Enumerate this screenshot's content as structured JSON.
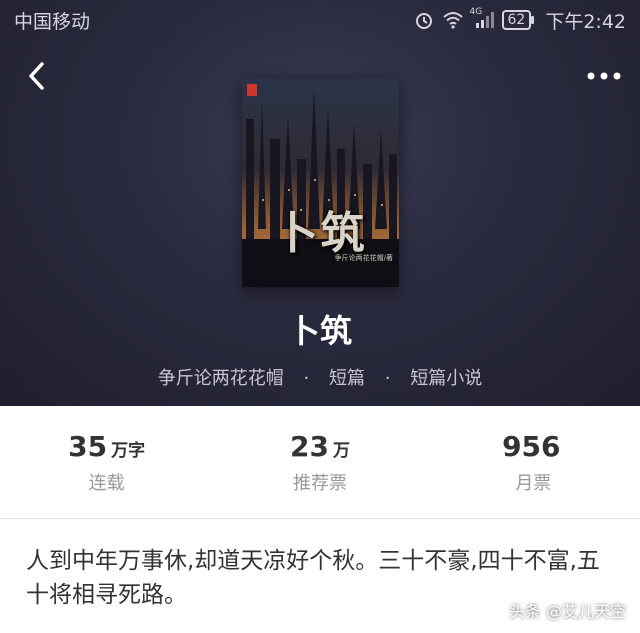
{
  "status_bar": {
    "carrier": "中国移动",
    "network": "4G",
    "battery": "62",
    "time": "下午2:42",
    "icons": [
      "alarm-icon",
      "wifi-icon",
      "signal-icon",
      "battery-icon"
    ]
  },
  "nav": {
    "back_icon": "chevron-left-icon",
    "more_icon": "more-dots-icon"
  },
  "cover": {
    "title": "卜筑",
    "author_line": "争斤论两花花帽/著"
  },
  "book": {
    "title": "卜筑",
    "author": "争斤论两花花帽",
    "separator": "·",
    "length": "短篇",
    "category": "短篇小说"
  },
  "stats": [
    {
      "value": "35",
      "unit": "万字",
      "label": "连载"
    },
    {
      "value": "23",
      "unit": "万",
      "label": "推荐票"
    },
    {
      "value": "956",
      "unit": "",
      "label": "月票"
    }
  ],
  "intro": "人到中年万事休,却道天凉好个秋。三十不豪,四十不富,五十将相寻死路。",
  "watermark": "头条 @艾儿天空"
}
